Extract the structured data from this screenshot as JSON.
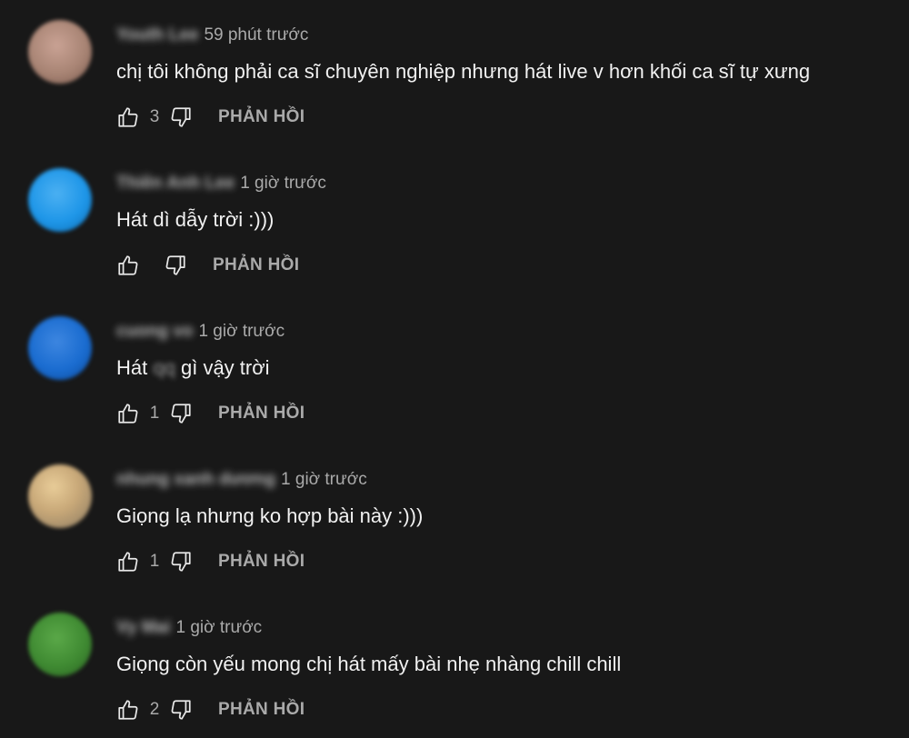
{
  "comments": [
    {
      "username": "Youth Lee",
      "timestamp": "59 phút trước",
      "text": "chị tôi không phải ca sĩ chuyên nghiệp nhưng hát live v hơn khối ca sĩ tự xưng",
      "likes": "3",
      "reply_label": "PHẢN HỒI",
      "avatar_color": "#a88474"
    },
    {
      "username": "Thiên Anh Lee",
      "timestamp": "1 giờ trước",
      "text": "Hát dì dẫy trời :)))",
      "likes": "",
      "reply_label": "PHẢN HỒI",
      "avatar_color": "#1e96e8"
    },
    {
      "username": "cuong vo",
      "timestamp": "1 giờ trước",
      "text_before": "Hát",
      "text_censored": "qq",
      "text_after": "gì vậy trời",
      "likes": "1",
      "reply_label": "PHẢN HỒI",
      "avatar_color": "#1a6cd0"
    },
    {
      "username": "nhung xanh dương",
      "timestamp": "1 giờ trước",
      "text": "Giọng lạ nhưng ko hợp bài này :)))",
      "likes": "1",
      "reply_label": "PHẢN HỒI",
      "avatar_color": "#c8a878"
    },
    {
      "username": "Vy Mai",
      "timestamp": "1 giờ trước",
      "text": "Giọng còn yếu mong chị hát mấy bài nhẹ nhàng chill chill",
      "likes": "2",
      "reply_label": "PHẢN HỒI",
      "avatar_color": "#3f8a32"
    }
  ],
  "icons": {
    "like": "thumbs-up-icon",
    "dislike": "thumbs-down-icon"
  },
  "colors": {
    "background": "#181818",
    "text_primary": "#f1f1f1",
    "text_secondary": "#aaaaaa"
  }
}
